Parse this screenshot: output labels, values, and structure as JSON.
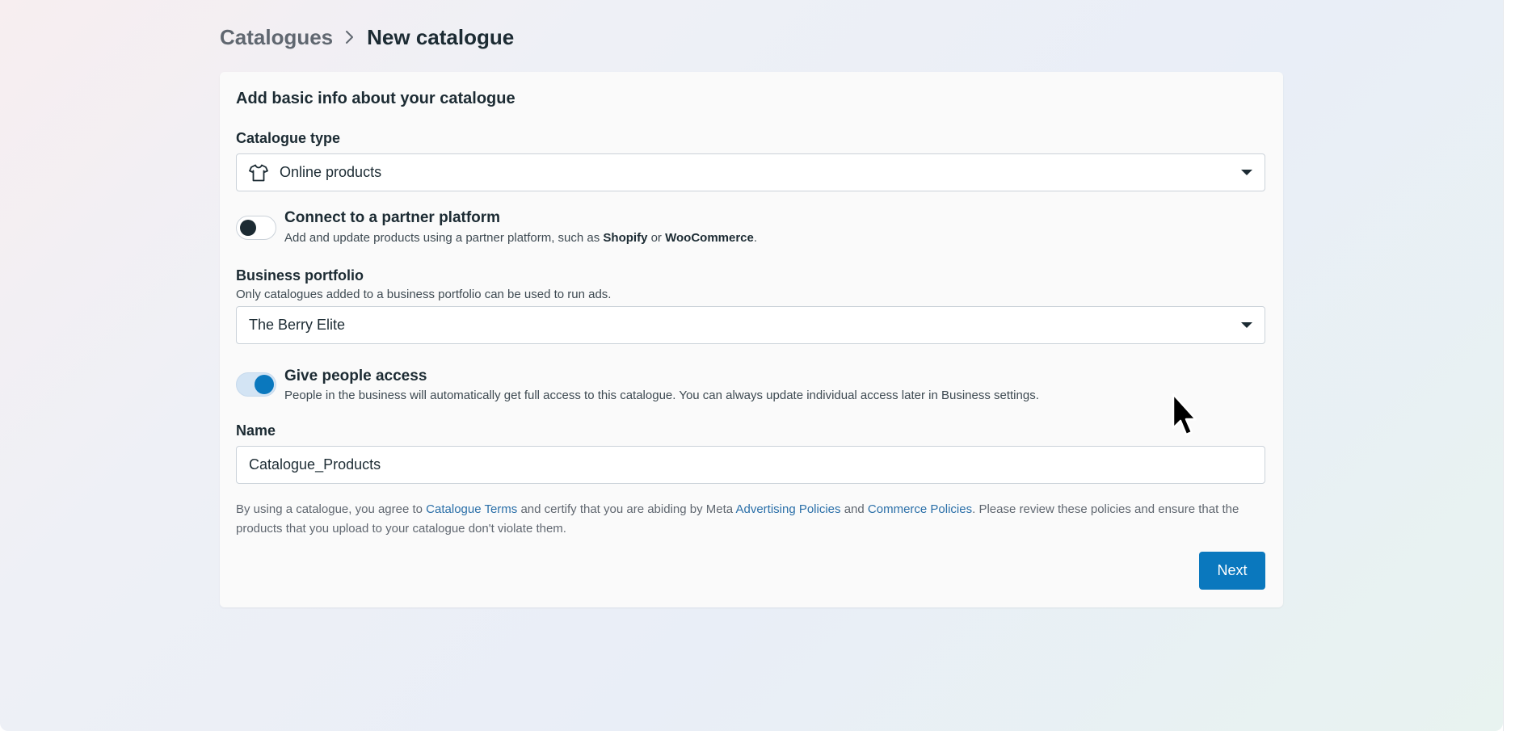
{
  "breadcrumb": {
    "parent": "Catalogues",
    "current": "New catalogue"
  },
  "form": {
    "title": "Add basic info about your catalogue",
    "catalogue_type": {
      "label": "Catalogue type",
      "value": "Online products",
      "icon": "shirt-icon"
    },
    "partner_platform": {
      "title": "Connect to a partner platform",
      "desc_prefix": "Add and update products using a partner platform, such as ",
      "shopify": "Shopify",
      "or": " or ",
      "woocommerce": "WooCommerce",
      "period": ".",
      "enabled": false
    },
    "business_portfolio": {
      "label": "Business portfolio",
      "helper": "Only catalogues added to a business portfolio can be used to run ads.",
      "value": "The Berry Elite"
    },
    "people_access": {
      "title": "Give people access",
      "desc": "People in the business will automatically get full access to this catalogue. You can always update individual access later in Business settings.",
      "enabled": true
    },
    "name": {
      "label": "Name",
      "value": "Catalogue_Products"
    },
    "legal": {
      "p1": "By using a catalogue, you agree to ",
      "link1": "Catalogue Terms",
      "p2": " and certify that you are abiding by Meta ",
      "link2": "Advertising Policies",
      "p3": " and ",
      "link3": "Commerce Policies",
      "p4": ". Please review these policies and ensure that the products that you upload to your catalogue don't violate them."
    },
    "next_label": "Next"
  },
  "colors": {
    "accent": "#0a78be",
    "link": "#2a6fa8",
    "text": "#1c2b33"
  }
}
